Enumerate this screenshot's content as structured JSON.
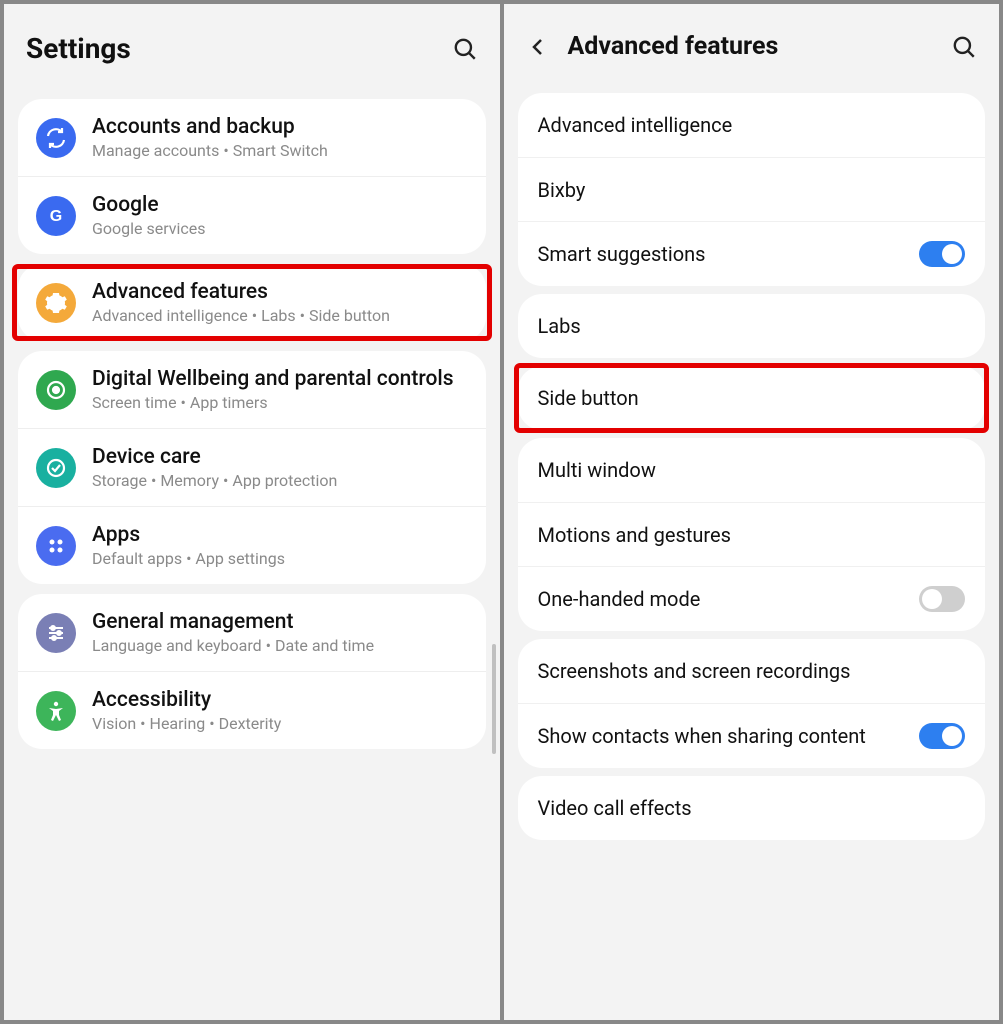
{
  "left": {
    "title": "Settings",
    "groups": [
      {
        "items": [
          {
            "icon": "sync",
            "color": "#3a6af0",
            "title": "Accounts and backup",
            "sub": "Manage accounts  •  Smart Switch"
          },
          {
            "icon": "g",
            "color": "#3a6af0",
            "title": "Google",
            "sub": "Google services"
          }
        ]
      },
      {
        "highlight": true,
        "items": [
          {
            "icon": "gear",
            "color": "#f4a93a",
            "title": "Advanced features",
            "sub": "Advanced intelligence  •  Labs  •  Side button"
          }
        ]
      },
      {
        "items": [
          {
            "icon": "wellbeing",
            "color": "#2fa84f",
            "title": "Digital Wellbeing and parental controls",
            "sub": "Screen time  •  App timers"
          },
          {
            "icon": "care",
            "color": "#19b0a0",
            "title": "Device care",
            "sub": "Storage  •  Memory  •  App protection"
          },
          {
            "icon": "apps",
            "color": "#4a6cf0",
            "title": "Apps",
            "sub": "Default apps  •  App settings"
          }
        ]
      },
      {
        "items": [
          {
            "icon": "sliders",
            "color": "#7a7fb5",
            "title": "General management",
            "sub": "Language and keyboard  •  Date and time"
          },
          {
            "icon": "accessibility",
            "color": "#3db55a",
            "title": "Accessibility",
            "sub": "Vision  •  Hearing  •  Dexterity"
          }
        ]
      }
    ]
  },
  "right": {
    "title": "Advanced features",
    "groups": [
      {
        "items": [
          {
            "title": "Advanced intelligence"
          },
          {
            "title": "Bixby"
          },
          {
            "title": "Smart suggestions",
            "toggle": true
          }
        ]
      },
      {
        "items": [
          {
            "title": "Labs"
          }
        ]
      },
      {
        "highlight": true,
        "items": [
          {
            "title": "Side button"
          }
        ]
      },
      {
        "items": [
          {
            "title": "Multi window"
          },
          {
            "title": "Motions and gestures"
          },
          {
            "title": "One-handed mode",
            "toggle": false
          }
        ]
      },
      {
        "items": [
          {
            "title": "Screenshots and screen recordings"
          },
          {
            "title": "Show contacts when sharing content",
            "toggle": true
          }
        ]
      },
      {
        "items": [
          {
            "title": "Video call effects"
          }
        ]
      }
    ]
  }
}
